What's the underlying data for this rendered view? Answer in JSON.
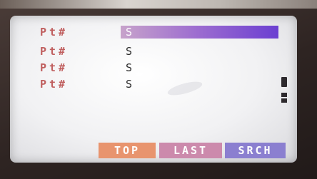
{
  "list": {
    "rows": [
      {
        "label": "Pt#",
        "value": "S",
        "selected": true
      },
      {
        "label": "Pt#",
        "value": "S",
        "selected": false
      },
      {
        "label": "Pt#",
        "value": "S",
        "selected": false
      },
      {
        "label": "Pt#",
        "value": "S",
        "selected": false
      }
    ]
  },
  "softkeys": {
    "top": "TOP",
    "last": "LAST",
    "srch": "SRCH"
  },
  "colors": {
    "label": "#c05f5f",
    "selection_start": "#c7a2cb",
    "selection_end": "#6b3fd1",
    "top_key": "#e8946e",
    "last_key": "#cc8aac",
    "srch_key": "#8b7fd0"
  }
}
